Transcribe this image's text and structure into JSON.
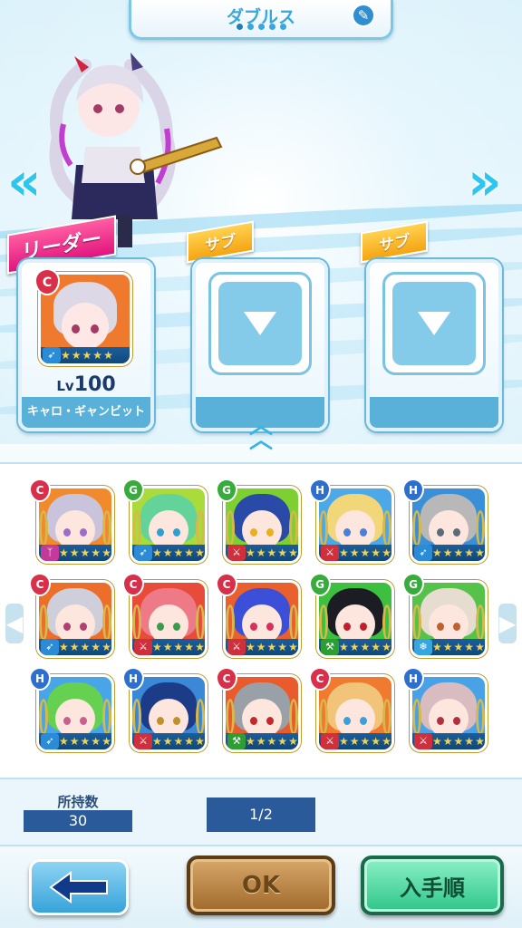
{
  "header": {
    "title": "ダブルス",
    "page_total": 5,
    "page_current": 1
  },
  "party": {
    "leader_tag": "リーダー",
    "leader": {
      "attribute": "C",
      "level_prefix": "Lv",
      "level": "100",
      "name": "キャロ・ギャンビット",
      "stars": 5,
      "weapon_icon": "bow-icon"
    },
    "sub_tag_1": "サブ",
    "sub_tag_2": "サブ"
  },
  "characters": [
    {
      "attribute": "C",
      "stars": 5,
      "weapon": "staff-icon",
      "hair": "#c9c3dc",
      "eyes": "#9a6ec8",
      "bg": "#f08a2c"
    },
    {
      "attribute": "G",
      "stars": 5,
      "weapon": "bow-icon",
      "hair": "#63d39a",
      "eyes": "#2f9fd0",
      "bg": "#a9dc3a"
    },
    {
      "attribute": "G",
      "stars": 5,
      "weapon": "sword-icon",
      "hair": "#2a4aa8",
      "eyes": "#e6b020",
      "bg": "#7ecf32"
    },
    {
      "attribute": "H",
      "stars": 5,
      "weapon": "sword-icon",
      "hair": "#f2d77a",
      "eyes": "#4a7fd8",
      "bg": "#4da8e8"
    },
    {
      "attribute": "H",
      "stars": 5,
      "weapon": "bow-icon",
      "hair": "#b8b8b8",
      "eyes": "#5c6a7a",
      "bg": "#3a8fd6"
    },
    {
      "attribute": "C",
      "stars": 5,
      "weapon": "bow-icon",
      "hair": "#cfcfdb",
      "eyes": "#b04070",
      "bg": "#ec6e2a"
    },
    {
      "attribute": "C",
      "stars": 5,
      "weapon": "sword-icon",
      "hair": "#ee7a88",
      "eyes": "#3c9a4c",
      "bg": "#e94b3a"
    },
    {
      "attribute": "C",
      "stars": 5,
      "weapon": "sword-icon",
      "hair": "#3c4fd8",
      "eyes": "#d8305c",
      "bg": "#e9602e"
    },
    {
      "attribute": "G",
      "stars": 5,
      "weapon": "hammer-icon",
      "hair": "#1c1c24",
      "eyes": "#c0202c",
      "bg": "#3dbf3f"
    },
    {
      "attribute": "G",
      "stars": 5,
      "weapon": "snowflake-icon",
      "hair": "#e6ddd0",
      "eyes": "#c06030",
      "bg": "#56c24a"
    },
    {
      "attribute": "H",
      "stars": 5,
      "weapon": "bow-icon",
      "hair": "#66d050",
      "eyes": "#c76090",
      "bg": "#48a6e6"
    },
    {
      "attribute": "H",
      "stars": 5,
      "weapon": "sword-icon",
      "hair": "#1c3c88",
      "eyes": "#c0902c",
      "bg": "#3b88d6"
    },
    {
      "attribute": "C",
      "stars": 5,
      "weapon": "hammer-icon",
      "hair": "#9aa0a8",
      "eyes": "#c02a2a",
      "bg": "#e95a2c"
    },
    {
      "attribute": "C",
      "stars": 5,
      "weapon": "sword-icon",
      "hair": "#f2c47a",
      "eyes": "#3c9fd8",
      "bg": "#ef7a30"
    },
    {
      "attribute": "H",
      "stars": 5,
      "weapon": "sword-icon",
      "hair": "#d8bcc0",
      "eyes": "#b03040",
      "bg": "#4aa2e6"
    }
  ],
  "info": {
    "owned_label": "所持数",
    "owned_value": "30",
    "page_indicator": "1/2"
  },
  "footer": {
    "ok_label": "OK",
    "sort_label": "入手順"
  }
}
